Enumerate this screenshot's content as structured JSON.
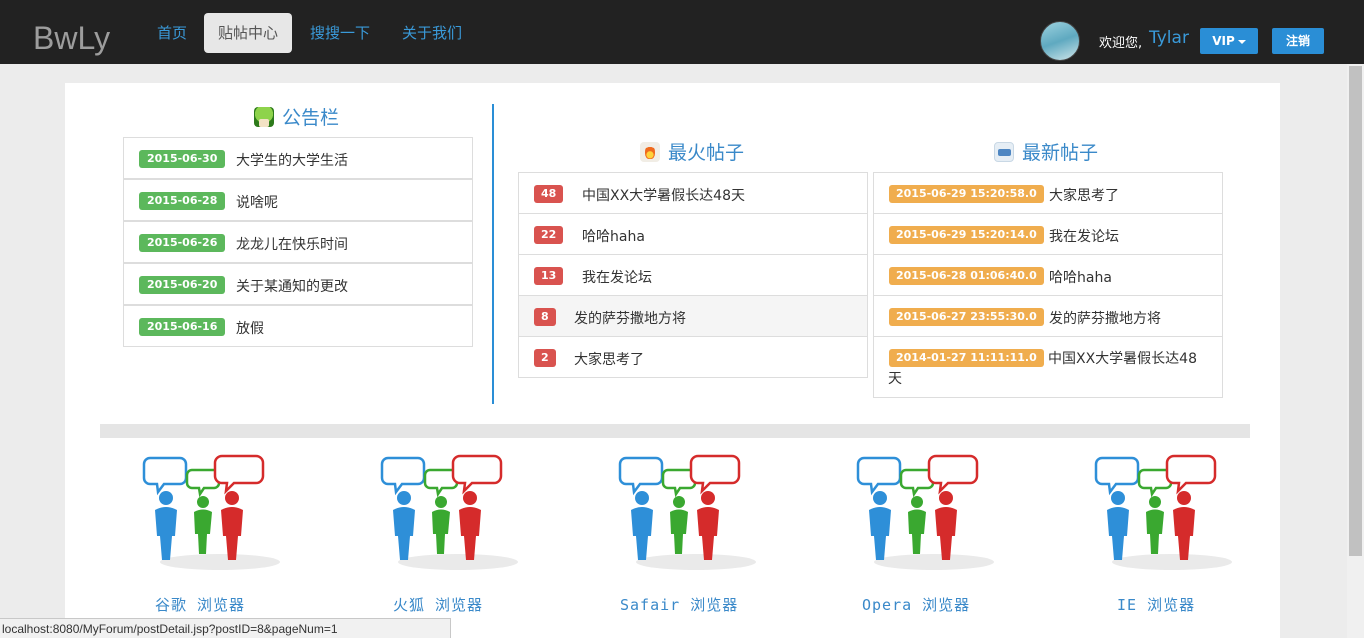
{
  "navbar": {
    "brand": "BwLy",
    "items": [
      {
        "label": "首页",
        "active": false
      },
      {
        "label": "贴帖中心",
        "active": true
      },
      {
        "label": "搜搜一下",
        "active": false
      },
      {
        "label": "关于我们",
        "active": false
      }
    ],
    "welcome": "欢迎您,",
    "username": "Tylar",
    "vip_label": "VIP",
    "logout_label": "注销"
  },
  "announcements": {
    "title": "公告栏",
    "items": [
      {
        "date": "2015-06-30",
        "text": "大学生的大学生活"
      },
      {
        "date": "2015-06-28",
        "text": "说啥呢"
      },
      {
        "date": "2015-06-26",
        "text": "龙龙儿在快乐时间"
      },
      {
        "date": "2015-06-20",
        "text": "关于某通知的更改"
      },
      {
        "date": "2015-06-16",
        "text": "放假"
      }
    ]
  },
  "hot_posts": {
    "title": "最火帖子",
    "items": [
      {
        "count": "48",
        "text": "中国XX大学暑假长达48天"
      },
      {
        "count": "22",
        "text": "哈哈haha"
      },
      {
        "count": "13",
        "text": "我在发论坛"
      },
      {
        "count": "8",
        "text": "发的萨芬撒地方将"
      },
      {
        "count": "2",
        "text": "大家思考了"
      }
    ]
  },
  "new_posts": {
    "title": "最新帖子",
    "items": [
      {
        "time": "2015-06-29 15:20:58.0",
        "text": "大家思考了"
      },
      {
        "time": "2015-06-29 15:20:14.0",
        "text": "我在发论坛"
      },
      {
        "time": "2015-06-28 01:06:40.0",
        "text": "哈哈haha"
      },
      {
        "time": "2015-06-27 23:55:30.0",
        "text": "发的萨芬撒地方将"
      },
      {
        "time": "2014-01-27 11:11:11.0",
        "text": "中国XX大学暑假长达48天"
      }
    ]
  },
  "browsers": [
    {
      "label": "谷歌 浏览器"
    },
    {
      "label": "火狐 浏览器"
    },
    {
      "label": "Safair 浏览器"
    },
    {
      "label": "Opera 浏览器"
    },
    {
      "label": "IE 浏览器"
    }
  ],
  "status_bar": "localhost:8080/MyForum/postDetail.jsp?postID=8&pageNum=1",
  "colors": {
    "navbar_bg": "#222222",
    "accent_blue": "#2a8ed6",
    "label_green": "#5cb85c",
    "label_red": "#d9534f",
    "label_orange": "#f0ad4e"
  }
}
